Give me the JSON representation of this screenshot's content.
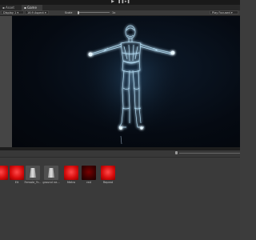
{
  "toolbar": {
    "play_icon": "play-icon",
    "pause_icon": "pause-icon",
    "step_icon": "step-icon"
  },
  "tabs": [
    {
      "label": "Asset Store",
      "icon": "asset-store-icon"
    },
    {
      "label": "Game",
      "icon": "game-icon"
    }
  ],
  "game_toolbar": {
    "display": "Display 1",
    "aspect": "16:9 Aspect",
    "scale_label": "Scale",
    "scale_value": "1x",
    "scale_level": 0.0,
    "play_focused": "Play Focused"
  },
  "viewport": {
    "subject": "glowing holographic humanoid figure in T-pose",
    "glow_color": "#bfe8ff"
  },
  "assets": [
    {
      "label": "",
      "style": "red"
    },
    {
      "label": "Elt",
      "style": "red"
    },
    {
      "label": "Female_Yr...",
      "style": "grey"
    },
    {
      "label": "ground ne...",
      "style": "grey"
    },
    {
      "label": "Metro",
      "style": "red"
    },
    {
      "label": "red",
      "style": "dark"
    },
    {
      "label": "Repeat",
      "style": "red"
    }
  ],
  "colors": {
    "editor_bg": "#3c3c3c",
    "viewport_bg": "#050a12",
    "material_red": "#d80d0d"
  }
}
